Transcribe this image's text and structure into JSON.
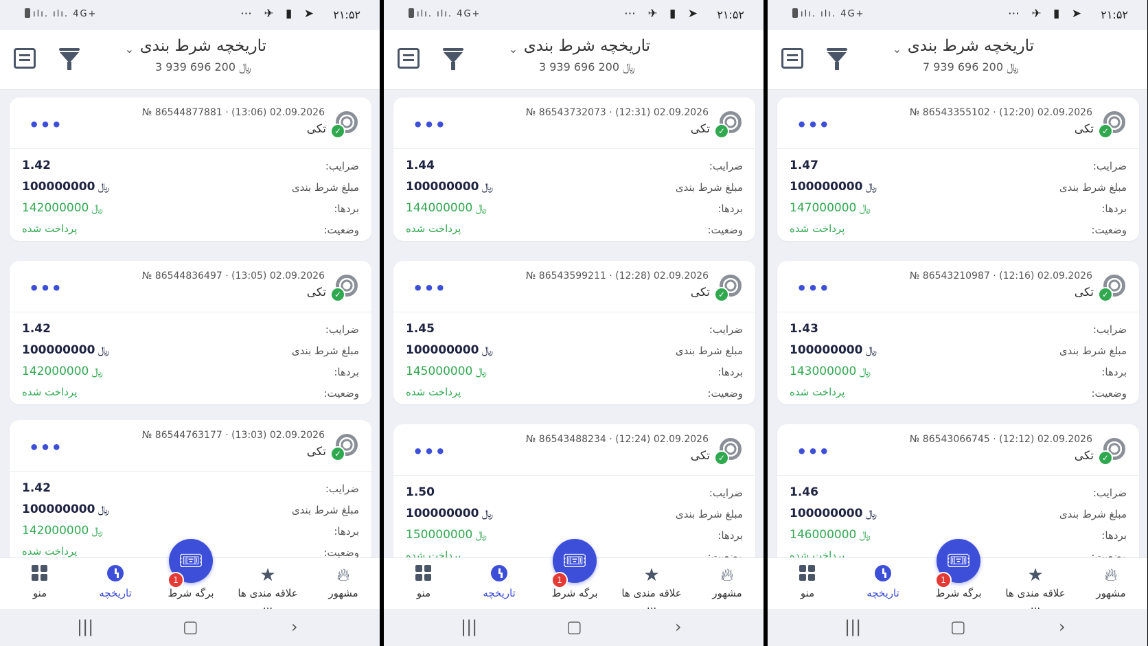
{
  "status_bar": {
    "time": "۲۱:۵۲",
    "signal": "ılı. ılı. 4G+",
    "notification_icons": "⋯ ✈ ▮ ➤"
  },
  "header": {
    "title": "تاریخچه شرط بندی",
    "currency": "﷼"
  },
  "labels": {
    "odds": "ضرایب:",
    "stake": "مبلغ شرط بندی",
    "winnings": "بردها:",
    "status": "وضعیت:",
    "type": "تکی",
    "status_value": "پرداخت شده"
  },
  "nav": {
    "popular": "مشهور",
    "favorites": "علاقه مندی ها ...",
    "betslip": "برگه شرط",
    "history": "تاریخچه",
    "menu": "منو",
    "badge": "1"
  },
  "phones": [
    {
      "balance": "3 939 696 200 ﷼",
      "bets": [
        {
          "meta": "№ 86544877881 · (13:06) 02.09.2026",
          "odds": "1.42",
          "stake": "100000000",
          "win": "142000000"
        },
        {
          "meta": "№ 86544836497 · (13:05) 02.09.2026",
          "odds": "1.42",
          "stake": "100000000",
          "win": "142000000"
        },
        {
          "meta": "№ 86544763177 · (13:03) 02.09.2026",
          "odds": "1.42",
          "stake": "100000000",
          "win": "142000000"
        }
      ]
    },
    {
      "balance": "3 939 696 200 ﷼",
      "bets": [
        {
          "meta": "№ 86543732073 · (12:31) 02.09.2026",
          "odds": "1.44",
          "stake": "100000000",
          "win": "144000000"
        },
        {
          "meta": "№ 86543599211 · (12:28) 02.09.2026",
          "odds": "1.45",
          "stake": "100000000",
          "win": "145000000"
        },
        {
          "meta": "№ 86543488234 · (12:24) 02.09.2026",
          "odds": "1.50",
          "stake": "100000000",
          "win": "150000000"
        }
      ]
    },
    {
      "balance": "7 939 696 200 ﷼",
      "bets": [
        {
          "meta": "№ 86543355102 · (12:20) 02.09.2026",
          "odds": "1.47",
          "stake": "100000000",
          "win": "147000000"
        },
        {
          "meta": "№ 86543210987 · (12:16) 02.09.2026",
          "odds": "1.43",
          "stake": "100000000",
          "win": "143000000"
        },
        {
          "meta": "№ 86543066745 · (12:12) 02.09.2026",
          "odds": "1.46",
          "stake": "100000000",
          "win": "146000000"
        }
      ]
    }
  ]
}
